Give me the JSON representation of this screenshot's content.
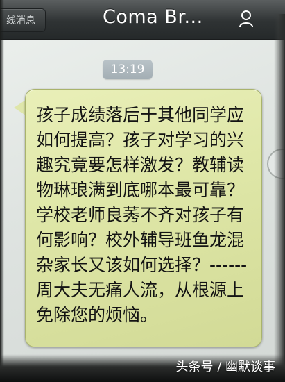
{
  "nav": {
    "back_label": "线消息",
    "title": "Coma Br...",
    "profile_icon": "person-icon"
  },
  "chat": {
    "timestamp": "13:19",
    "message": "孩子成绩落后于其他同学应如何提高？孩子对学习的兴趣究竟要怎样激发？教辅读物琳琅满到底哪本最可靠？学校老师良莠不齐对孩子有何影响？校外辅导班鱼龙混杂家长又该如何选择？------周大夫无痛人流，从根源上免除您的烦恼。"
  },
  "watermark": "头条号 / 幽默谈事",
  "colors": {
    "bubble": "#dfe7a8",
    "nav": "#2f3334",
    "timestamp_bg": "#a9b4ba"
  }
}
